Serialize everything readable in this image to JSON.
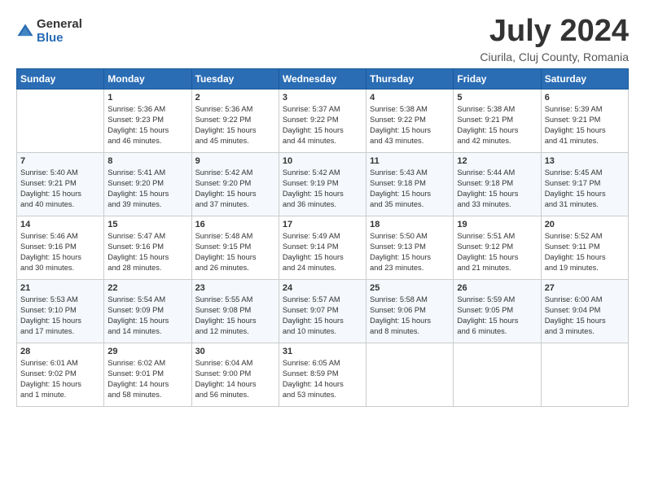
{
  "logo": {
    "general": "General",
    "blue": "Blue"
  },
  "title": "July 2024",
  "subtitle": "Ciurila, Cluj County, Romania",
  "headers": [
    "Sunday",
    "Monday",
    "Tuesday",
    "Wednesday",
    "Thursday",
    "Friday",
    "Saturday"
  ],
  "weeks": [
    [
      {
        "day": "",
        "content": ""
      },
      {
        "day": "1",
        "content": "Sunrise: 5:36 AM\nSunset: 9:23 PM\nDaylight: 15 hours\nand 46 minutes."
      },
      {
        "day": "2",
        "content": "Sunrise: 5:36 AM\nSunset: 9:22 PM\nDaylight: 15 hours\nand 45 minutes."
      },
      {
        "day": "3",
        "content": "Sunrise: 5:37 AM\nSunset: 9:22 PM\nDaylight: 15 hours\nand 44 minutes."
      },
      {
        "day": "4",
        "content": "Sunrise: 5:38 AM\nSunset: 9:22 PM\nDaylight: 15 hours\nand 43 minutes."
      },
      {
        "day": "5",
        "content": "Sunrise: 5:38 AM\nSunset: 9:21 PM\nDaylight: 15 hours\nand 42 minutes."
      },
      {
        "day": "6",
        "content": "Sunrise: 5:39 AM\nSunset: 9:21 PM\nDaylight: 15 hours\nand 41 minutes."
      }
    ],
    [
      {
        "day": "7",
        "content": "Sunrise: 5:40 AM\nSunset: 9:21 PM\nDaylight: 15 hours\nand 40 minutes."
      },
      {
        "day": "8",
        "content": "Sunrise: 5:41 AM\nSunset: 9:20 PM\nDaylight: 15 hours\nand 39 minutes."
      },
      {
        "day": "9",
        "content": "Sunrise: 5:42 AM\nSunset: 9:20 PM\nDaylight: 15 hours\nand 37 minutes."
      },
      {
        "day": "10",
        "content": "Sunrise: 5:42 AM\nSunset: 9:19 PM\nDaylight: 15 hours\nand 36 minutes."
      },
      {
        "day": "11",
        "content": "Sunrise: 5:43 AM\nSunset: 9:18 PM\nDaylight: 15 hours\nand 35 minutes."
      },
      {
        "day": "12",
        "content": "Sunrise: 5:44 AM\nSunset: 9:18 PM\nDaylight: 15 hours\nand 33 minutes."
      },
      {
        "day": "13",
        "content": "Sunrise: 5:45 AM\nSunset: 9:17 PM\nDaylight: 15 hours\nand 31 minutes."
      }
    ],
    [
      {
        "day": "14",
        "content": "Sunrise: 5:46 AM\nSunset: 9:16 PM\nDaylight: 15 hours\nand 30 minutes."
      },
      {
        "day": "15",
        "content": "Sunrise: 5:47 AM\nSunset: 9:16 PM\nDaylight: 15 hours\nand 28 minutes."
      },
      {
        "day": "16",
        "content": "Sunrise: 5:48 AM\nSunset: 9:15 PM\nDaylight: 15 hours\nand 26 minutes."
      },
      {
        "day": "17",
        "content": "Sunrise: 5:49 AM\nSunset: 9:14 PM\nDaylight: 15 hours\nand 24 minutes."
      },
      {
        "day": "18",
        "content": "Sunrise: 5:50 AM\nSunset: 9:13 PM\nDaylight: 15 hours\nand 23 minutes."
      },
      {
        "day": "19",
        "content": "Sunrise: 5:51 AM\nSunset: 9:12 PM\nDaylight: 15 hours\nand 21 minutes."
      },
      {
        "day": "20",
        "content": "Sunrise: 5:52 AM\nSunset: 9:11 PM\nDaylight: 15 hours\nand 19 minutes."
      }
    ],
    [
      {
        "day": "21",
        "content": "Sunrise: 5:53 AM\nSunset: 9:10 PM\nDaylight: 15 hours\nand 17 minutes."
      },
      {
        "day": "22",
        "content": "Sunrise: 5:54 AM\nSunset: 9:09 PM\nDaylight: 15 hours\nand 14 minutes."
      },
      {
        "day": "23",
        "content": "Sunrise: 5:55 AM\nSunset: 9:08 PM\nDaylight: 15 hours\nand 12 minutes."
      },
      {
        "day": "24",
        "content": "Sunrise: 5:57 AM\nSunset: 9:07 PM\nDaylight: 15 hours\nand 10 minutes."
      },
      {
        "day": "25",
        "content": "Sunrise: 5:58 AM\nSunset: 9:06 PM\nDaylight: 15 hours\nand 8 minutes."
      },
      {
        "day": "26",
        "content": "Sunrise: 5:59 AM\nSunset: 9:05 PM\nDaylight: 15 hours\nand 6 minutes."
      },
      {
        "day": "27",
        "content": "Sunrise: 6:00 AM\nSunset: 9:04 PM\nDaylight: 15 hours\nand 3 minutes."
      }
    ],
    [
      {
        "day": "28",
        "content": "Sunrise: 6:01 AM\nSunset: 9:02 PM\nDaylight: 15 hours\nand 1 minute."
      },
      {
        "day": "29",
        "content": "Sunrise: 6:02 AM\nSunset: 9:01 PM\nDaylight: 14 hours\nand 58 minutes."
      },
      {
        "day": "30",
        "content": "Sunrise: 6:04 AM\nSunset: 9:00 PM\nDaylight: 14 hours\nand 56 minutes."
      },
      {
        "day": "31",
        "content": "Sunrise: 6:05 AM\nSunset: 8:59 PM\nDaylight: 14 hours\nand 53 minutes."
      },
      {
        "day": "",
        "content": ""
      },
      {
        "day": "",
        "content": ""
      },
      {
        "day": "",
        "content": ""
      }
    ]
  ]
}
